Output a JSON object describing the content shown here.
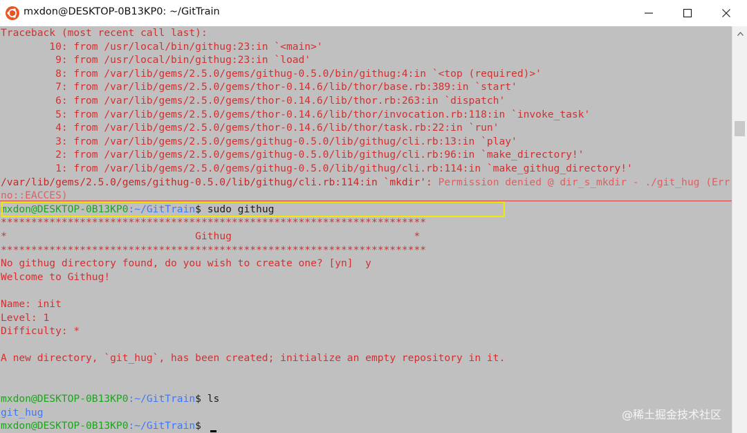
{
  "window": {
    "title": "mxdon@DESKTOP-0B13KP0: ~/GitTrain",
    "icon": "ubuntu-icon",
    "controls": [
      "minimize-icon",
      "maximize-icon",
      "close-icon"
    ]
  },
  "colors": {
    "terminal_bg": "#c0c0c0",
    "prompt_user": "#1aa61a",
    "prompt_path": "#3b78ff",
    "error_text": "#d32f2f",
    "highlight_box": "#f3ea00"
  },
  "terminal": {
    "traceback": [
      "Traceback (most recent call last):",
      "        10: from /usr/local/bin/githug:23:in `<main>'",
      "         9: from /usr/local/bin/githug:23:in `load'",
      "         8: from /var/lib/gems/2.5.0/gems/githug-0.5.0/bin/githug:4:in `<top (required)>'",
      "         7: from /var/lib/gems/2.5.0/gems/thor-0.14.6/lib/thor/base.rb:389:in `start'",
      "         6: from /var/lib/gems/2.5.0/gems/thor-0.14.6/lib/thor.rb:263:in `dispatch'",
      "         5: from /var/lib/gems/2.5.0/gems/thor-0.14.6/lib/thor/invocation.rb:118:in `invoke_task'",
      "         4: from /var/lib/gems/2.5.0/gems/thor-0.14.6/lib/thor/task.rb:22:in `run'",
      "         3: from /var/lib/gems/2.5.0/gems/githug-0.5.0/lib/githug/cli.rb:13:in `play'",
      "         2: from /var/lib/gems/2.5.0/gems/githug-0.5.0/lib/githug/cli.rb:96:in `make_directory!'",
      "         1: from /var/lib/gems/2.5.0/gems/githug-0.5.0/lib/githug/cli.rb:114:in `make_githug_directory!'"
    ],
    "error_line": {
      "location": "/var/lib/gems/2.5.0/gems/githug-0.5.0/lib/githug/cli.rb:114:in `mkdir':",
      "message": " Permission denied @ dir_s_mkdir - ./git_hug (Err",
      "continuation": "no::EACCES)"
    },
    "prompt1": {
      "user": "mxdon@DESKTOP-0B13KP0",
      "path": ":~/GitTrain",
      "dollar": "$",
      "command": " sudo githug"
    },
    "banner": {
      "stars": "**********************************************************************",
      "left": "*",
      "title": "                               Githug                              ",
      "right": "*"
    },
    "output": [
      "No githug directory found, do you wish to create one? [yn]  y",
      "Welcome to Githug!",
      "",
      "Name: init",
      "Level: 1",
      "Difficulty: *",
      "",
      "A new directory, `git_hug`, has been created; initialize an empty repository in it.",
      ""
    ],
    "prompt2": {
      "user": "mxdon@DESKTOP-0B13KP0",
      "path": ":~/GitTrain",
      "dollar": "$",
      "command": " ls"
    },
    "ls_output": "git_hug",
    "prompt3": {
      "user": "mxdon@DESKTOP-0B13KP0",
      "path": ":~/GitTrain",
      "dollar": "$",
      "command": " "
    }
  },
  "watermark": "@稀土掘金技术社区"
}
